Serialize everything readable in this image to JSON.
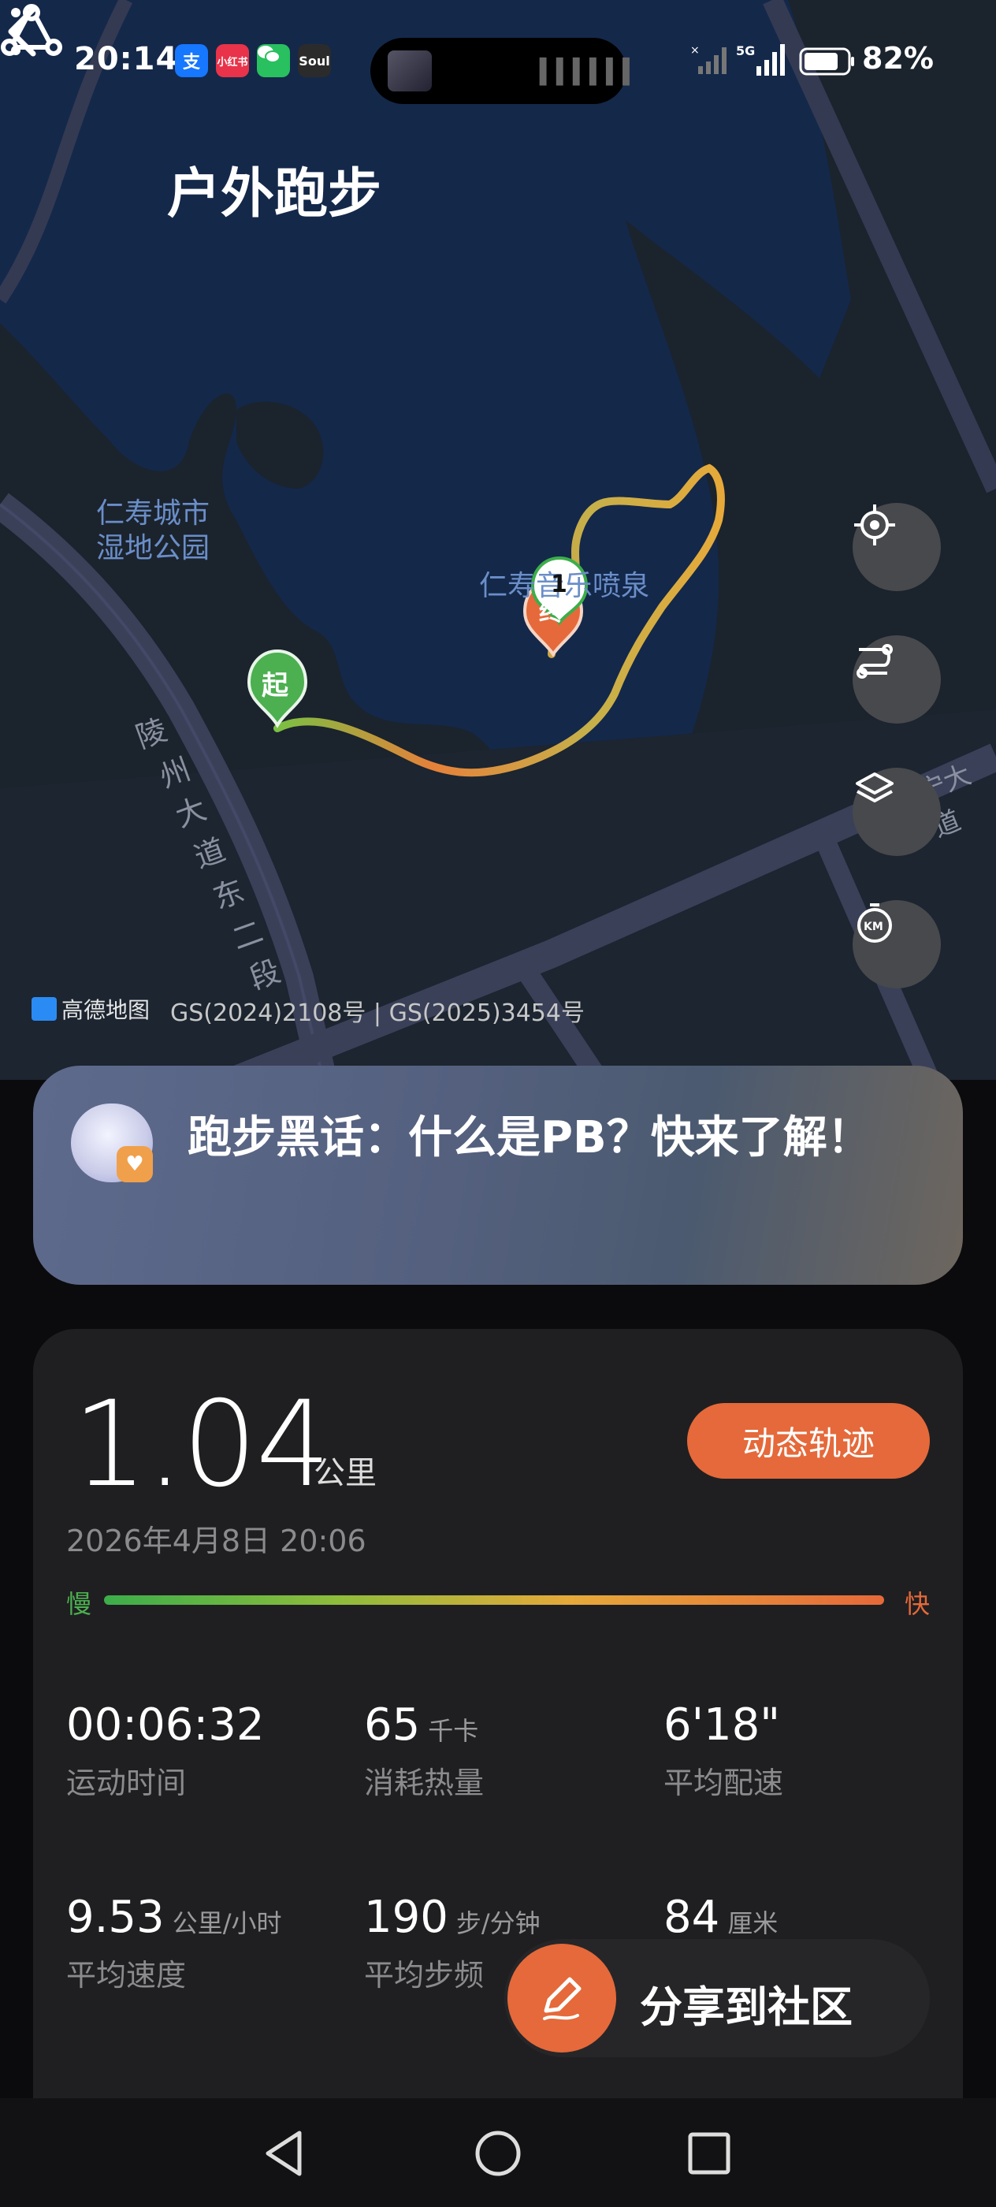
{
  "status": {
    "time": "20:14",
    "apps": [
      {
        "name": "alipay-icon",
        "glyph": "支",
        "color": "#1677ff"
      },
      {
        "name": "xiaohongshu-icon",
        "glyph": "小红书",
        "color": "#e8334a"
      },
      {
        "name": "wechat-icon",
        "glyph": "",
        "color": "#29c05f"
      },
      {
        "name": "soul-icon",
        "glyph": "Soul",
        "color": "#2b2b2b"
      }
    ],
    "network": "5G",
    "battery": "82%"
  },
  "header": {
    "title": "户外跑步"
  },
  "map": {
    "label_park": [
      "仁寿城市",
      "湿地公园"
    ],
    "label_fountain": "仁寿音乐喷泉",
    "label_road1": [
      "陵",
      "州",
      "大",
      "道",
      "东",
      "二",
      "段"
    ],
    "label_road2": "宁大道",
    "start_marker": "起",
    "end_marker": "终",
    "km_marker": "1",
    "amap_logo": "高德地图",
    "copyright": "GS(2024)2108号 | GS(2025)3454号"
  },
  "tip": {
    "text": "跑步黑话：什么是PB？快来了解！"
  },
  "summary": {
    "distance": "1.04",
    "distance_unit": "公里",
    "dynamic_track_button": "动态轨迹",
    "datetime": "2026年4月8日 20:06",
    "slow_label": "慢",
    "fast_label": "快"
  },
  "stats": [
    {
      "value": "00:06:32",
      "unit": "",
      "label": "运动时间"
    },
    {
      "value": "65",
      "unit": "千卡",
      "label": "消耗热量"
    },
    {
      "value": "6'18\"",
      "unit": "",
      "label": "平均配速"
    },
    {
      "value": "9.53",
      "unit": "公里/小时",
      "label": "平均速度"
    },
    {
      "value": "190",
      "unit": "步/分钟",
      "label": "平均步频"
    },
    {
      "value": "84",
      "unit": "厘米",
      "label": ""
    }
  ],
  "share": {
    "label": "分享到社区"
  },
  "colors": {
    "accent": "#e5693a",
    "slow": "#3cae4a",
    "map_water": "#16284a",
    "card": "#1f1f21"
  }
}
